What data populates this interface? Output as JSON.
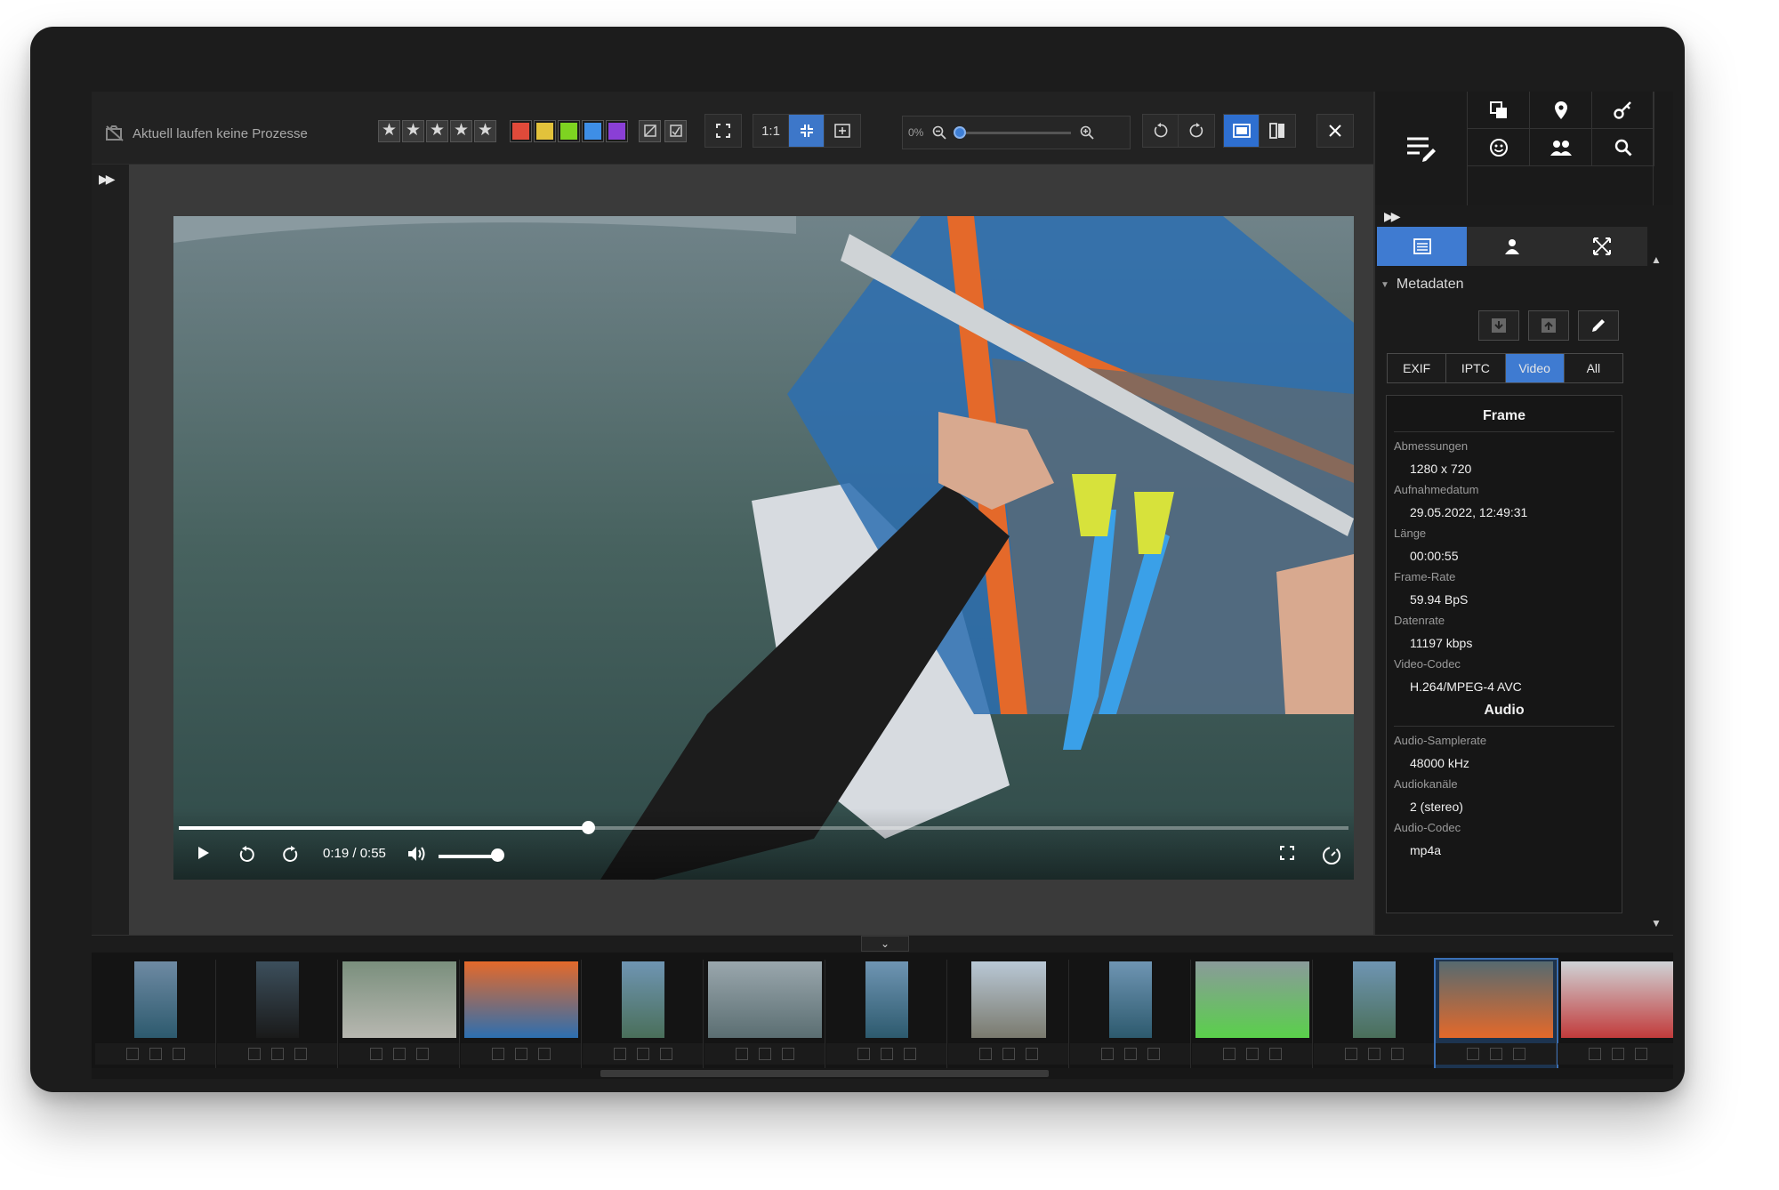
{
  "toolbar": {
    "status": "Aktuell laufen keine Prozesse",
    "stars": [
      "★",
      "★",
      "★",
      "★",
      "★"
    ],
    "color_labels": [
      "#e04a3a",
      "#e2c23b",
      "#7ed321",
      "#3e8ee6",
      "#8a3fd6"
    ],
    "one_to_one": "1:1",
    "zoom_percent": "0%"
  },
  "video": {
    "time": "0:19 / 0:55",
    "progress": 0.35,
    "volume": 0.85
  },
  "side": {
    "section": "Metadaten",
    "tabs": [
      "EXIF",
      "IPTC",
      "Video",
      "All"
    ],
    "active_tab": "Video",
    "frame": {
      "title": "Frame",
      "fields": [
        {
          "label": "Abmessungen",
          "value": "1280 x 720"
        },
        {
          "label": "Aufnahmedatum",
          "value": "29.05.2022, 12:49:31"
        },
        {
          "label": "Länge",
          "value": "00:00:55"
        },
        {
          "label": "Frame-Rate",
          "value": "59.94 BpS"
        },
        {
          "label": "Datenrate",
          "value": "11197 kbps"
        },
        {
          "label": "Video-Codec",
          "value": "H.264/MPEG-4 AVC"
        }
      ]
    },
    "audio": {
      "title": "Audio",
      "fields": [
        {
          "label": "Audio-Samplerate",
          "value": "48000 kHz"
        },
        {
          "label": "Audiokanäle",
          "value": "2 (stereo)"
        },
        {
          "label": "Audio-Codec",
          "value": "mp4a"
        }
      ]
    }
  },
  "icons": {
    "metadata_edit": "metadata-edit-icon",
    "grid": [
      "copy-icon",
      "location-pin-icon",
      "key-icon",
      "face-icon",
      "people-icon",
      "search-icon"
    ]
  },
  "colors": {
    "accent": "#3f7bd1"
  }
}
